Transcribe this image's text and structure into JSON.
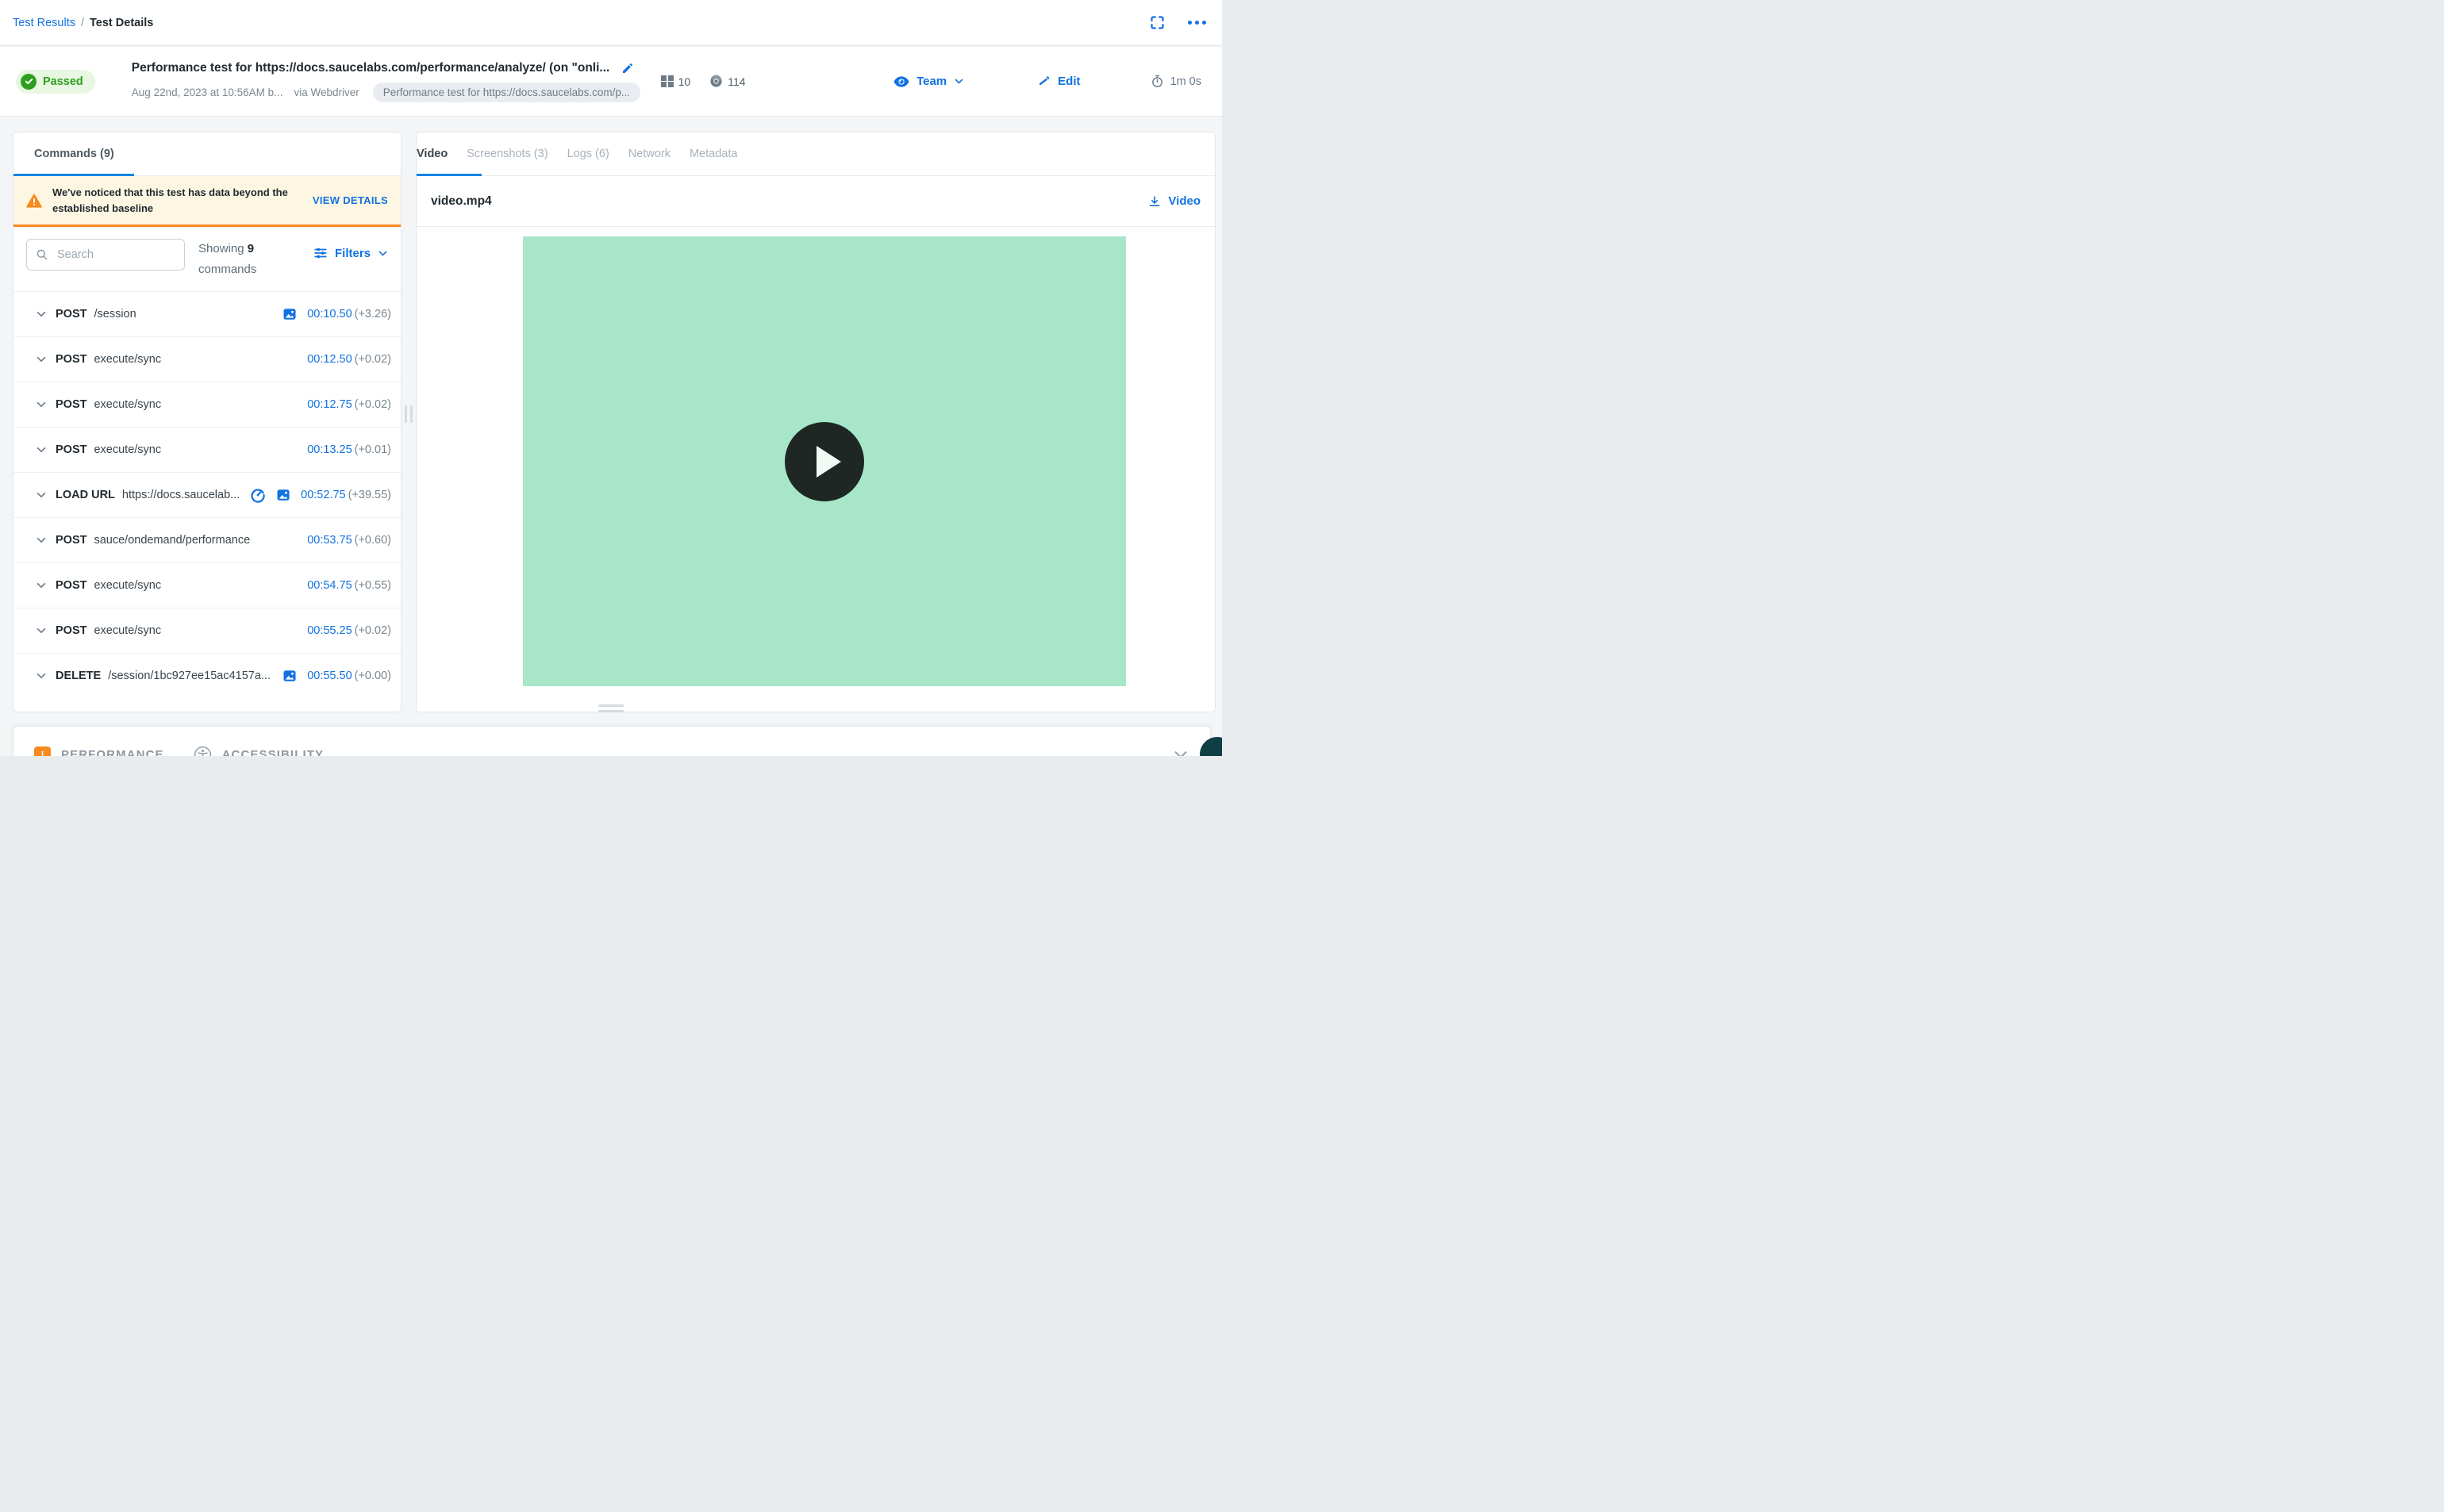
{
  "colors": {
    "accent_blue": "#1272e0",
    "tab_underline_blue": "#1285e8",
    "warning_orange": "#f68b1f",
    "passed_green": "#2f9e1f",
    "passed_bg": "#e7f7e1",
    "video_placeholder_green": "#a7e6c8"
  },
  "breadcrumb": {
    "link": "Test Results",
    "separator": "/",
    "current": "Test Details"
  },
  "header": {
    "status": "Passed",
    "title": "Performance test for https://docs.saucelabs.com/performance/analyze/ (on \"onli...",
    "date": "Aug 22nd, 2023 at 10:56AM b...",
    "via": "via Webdriver",
    "tag": "Performance test for https://docs.saucelabs.com/p...",
    "os_version": "10",
    "browser_version": "114",
    "team_label": "Team",
    "edit_label": "Edit",
    "duration": "1m 0s"
  },
  "commands_panel": {
    "tab_label": "Commands (9)",
    "warning": {
      "text": "We've noticed that this test has data beyond the established baseline",
      "action": "VIEW DETAILS"
    },
    "search_placeholder": "Search",
    "showing_prefix": "Showing",
    "showing_count": "9",
    "showing_suffix": "commands",
    "filters_label": "Filters",
    "rows": [
      {
        "method": "POST",
        "path": "/session",
        "icons": [
          "screenshot"
        ],
        "time": "00:10.50",
        "delta": "(+3.26)"
      },
      {
        "method": "POST",
        "path": "execute/sync",
        "icons": [],
        "time": "00:12.50",
        "delta": "(+0.02)"
      },
      {
        "method": "POST",
        "path": "execute/sync",
        "icons": [],
        "time": "00:12.75",
        "delta": "(+0.02)"
      },
      {
        "method": "POST",
        "path": "execute/sync",
        "icons": [],
        "time": "00:13.25",
        "delta": "(+0.01)"
      },
      {
        "method": "LOAD URL",
        "path": "https://docs.saucelab...",
        "icons": [
          "performance-gauge",
          "screenshot"
        ],
        "time": "00:52.75",
        "delta": "(+39.55)"
      },
      {
        "method": "POST",
        "path": "sauce/ondemand/performance",
        "icons": [],
        "time": "00:53.75",
        "delta": "(+0.60)"
      },
      {
        "method": "POST",
        "path": "execute/sync",
        "icons": [],
        "time": "00:54.75",
        "delta": "(+0.55)"
      },
      {
        "method": "POST",
        "path": "execute/sync",
        "icons": [],
        "time": "00:55.25",
        "delta": "(+0.02)"
      },
      {
        "method": "DELETE",
        "path": "/session/1bc927ee15ac4157a...",
        "icons": [
          "screenshot"
        ],
        "time": "00:55.50",
        "delta": "(+0.00)"
      }
    ]
  },
  "right_panel": {
    "tabs": [
      "Video",
      "Screenshots (3)",
      "Logs (6)",
      "Network",
      "Metadata"
    ],
    "active_tab": "Video",
    "file_name": "video.mp4",
    "download_label": "Video"
  },
  "bottom_bar": {
    "performance_label": "PERFORMANCE",
    "accessibility_label": "ACCESSIBILITY"
  }
}
